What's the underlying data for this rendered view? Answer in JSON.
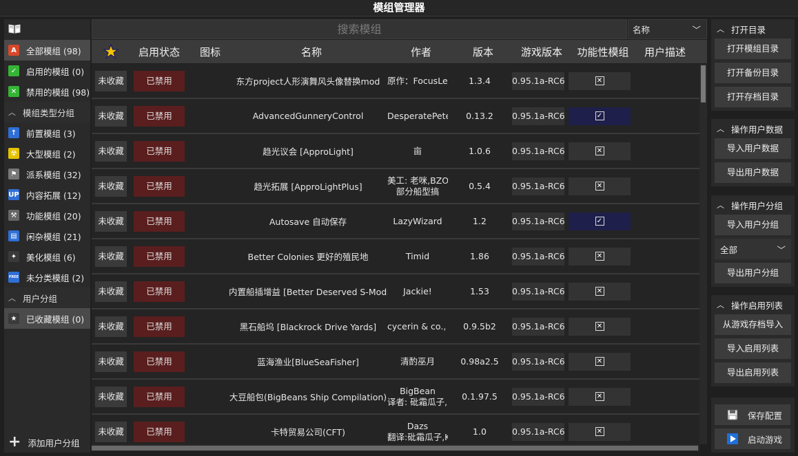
{
  "window": {
    "title": "模组管理器"
  },
  "sidebar": {
    "book_icon": "book-icon",
    "items": [
      {
        "label": "全部模组 (98)",
        "icon": "all-mods-icon",
        "color": "#d9472b",
        "glyph": "A",
        "active": true
      },
      {
        "label": "启用的模组 (0)",
        "icon": "enabled-check-icon",
        "color": "#35b535",
        "glyph": "✓"
      },
      {
        "label": "禁用的模组 (98)",
        "icon": "disabled-x-icon",
        "color": "#35b535",
        "glyph": "✕"
      }
    ],
    "type_group_label": "模组类型分组",
    "type_items": [
      {
        "label": "前置模组 (3)",
        "icon": "prerequisite-icon",
        "color": "#2f6fd6",
        "glyph": "↑"
      },
      {
        "label": "大型模组 (2)",
        "icon": "radiation-icon",
        "color": "#e5c200",
        "glyph": "☢"
      },
      {
        "label": "派系模组 (32)",
        "icon": "flag-icon",
        "color": "#777777",
        "glyph": "⚑"
      },
      {
        "label": "内容拓展 (12)",
        "icon": "expansion-icon",
        "color": "#2f6fd6",
        "glyph": "UP"
      },
      {
        "label": "功能模组 (20)",
        "icon": "tools-icon",
        "color": "#666666",
        "glyph": "⚒"
      },
      {
        "label": "闲杂模组 (21)",
        "icon": "misc-icon",
        "color": "#2f6fd6",
        "glyph": "▤"
      },
      {
        "label": "美化模组 (6)",
        "icon": "sparkle-icon",
        "color": "#3a3a3a",
        "glyph": "✦"
      },
      {
        "label": "未分类模组 (2)",
        "icon": "free-icon",
        "color": "#2f6fd6",
        "glyph": "FREE"
      }
    ],
    "user_group_label": "用户分组",
    "user_items": [
      {
        "label": "已收藏模组 (0)",
        "icon": "favorite-star-icon",
        "color": "#3a3a3a",
        "glyph": "★"
      }
    ],
    "add_group_label": "添加用户分组"
  },
  "search": {
    "placeholder": "搜索模组"
  },
  "sort": {
    "selected": "名称"
  },
  "table": {
    "headers": [
      "",
      "启用状态",
      "图标",
      "名称",
      "作者",
      "版本",
      "游戏版本",
      "功能性模组",
      "用户描述"
    ],
    "rows": [
      {
        "fav": "未收藏",
        "status": "已禁用",
        "name": "东方project人形演舞风头像替换mod",
        "author": "原作：FocusLen",
        "author2": "",
        "version": "1.3.4",
        "game": "0.95.1a-RC6",
        "func": false
      },
      {
        "fav": "未收藏",
        "status": "已禁用",
        "name": "AdvancedGunneryControl",
        "author": "DesperatePete",
        "author2": "",
        "version": "0.13.2",
        "game": "0.95.1a-RC6",
        "func": true
      },
      {
        "fav": "未收藏",
        "status": "已禁用",
        "name": "趋光议会 [ApproLight]",
        "author": "                 亩",
        "author2": "",
        "version": "1.0.6",
        "game": "0.95.1a-RC6",
        "func": false
      },
      {
        "fav": "未收藏",
        "status": "已禁用",
        "name": "趋光拓展 [ApproLightPlus]",
        "author": "美工: 老咪,BZOn",
        "author2": "部分船型搞",
        "version": "0.5.4",
        "game": "0.95.1a-RC6",
        "func": false
      },
      {
        "fav": "未收藏",
        "status": "已禁用",
        "name": "Autosave 自动保存",
        "author": "LazyWizard",
        "author2": "",
        "version": "1.2",
        "game": "0.95.1a-RC6",
        "func": true
      },
      {
        "fav": "未收藏",
        "status": "已禁用",
        "name": "Better Colonies 更好的殖民地",
        "author": "Timid",
        "author2": "",
        "version": "1.86",
        "game": "0.95.1a-RC6",
        "func": false
      },
      {
        "fav": "未收藏",
        "status": "已禁用",
        "name": "内置船插增益 [Better Deserved S-Mods]",
        "author": "Jackie!",
        "author2": "",
        "version": "1.53",
        "game": "0.95.1a-RC6",
        "func": false
      },
      {
        "fav": "未收藏",
        "status": "已禁用",
        "name": "黑石船坞 [Blackrock Drive Yards]",
        "author": "cycerin & co., p",
        "author2": "",
        "version": "0.9.5b2",
        "game": "0.95.1a-RC6",
        "func": false
      },
      {
        "fav": "未收藏",
        "status": "已禁用",
        "name": "蓝海渔业[BlueSeaFisher]",
        "author": "清酌巫月",
        "author2": "",
        "version": "0.98a2.5",
        "game": "0.95.1a-RC6",
        "func": false
      },
      {
        "fav": "未收藏",
        "status": "已禁用",
        "name": "大豆船包(BigBeans Ship Compilation)",
        "author": "BigBean",
        "author2": "译者: 砒霜瓜子,K",
        "version": "0.1.97.5",
        "game": "0.95.1a-RC6",
        "func": false
      },
      {
        "fav": "未收藏",
        "status": "已禁用",
        "name": "卡特贸易公司(CFT)",
        "author": "Dazs",
        "author2": "翻译:砒霜瓜子,K",
        "version": "1.0",
        "game": "0.95.1a-RC6",
        "func": false
      }
    ]
  },
  "right_panel": {
    "dir_group": {
      "label": "打开目录",
      "buttons": [
        "打开模组目录",
        "打开备份目录",
        "打开存档目录"
      ]
    },
    "userdata_group": {
      "label": "操作用户数据",
      "buttons": [
        "导入用户数据",
        "导出用户数据"
      ]
    },
    "usergroup_group": {
      "label": "操作用户分组",
      "import": "导入用户分组",
      "select": "全部",
      "export": "导出用户分组"
    },
    "enable_group": {
      "label": "操作启用列表",
      "buttons": [
        "从游戏存档导入",
        "导入启用列表",
        "导出启用列表"
      ]
    },
    "save_label": "保存配置",
    "launch_label": "启动游戏"
  }
}
